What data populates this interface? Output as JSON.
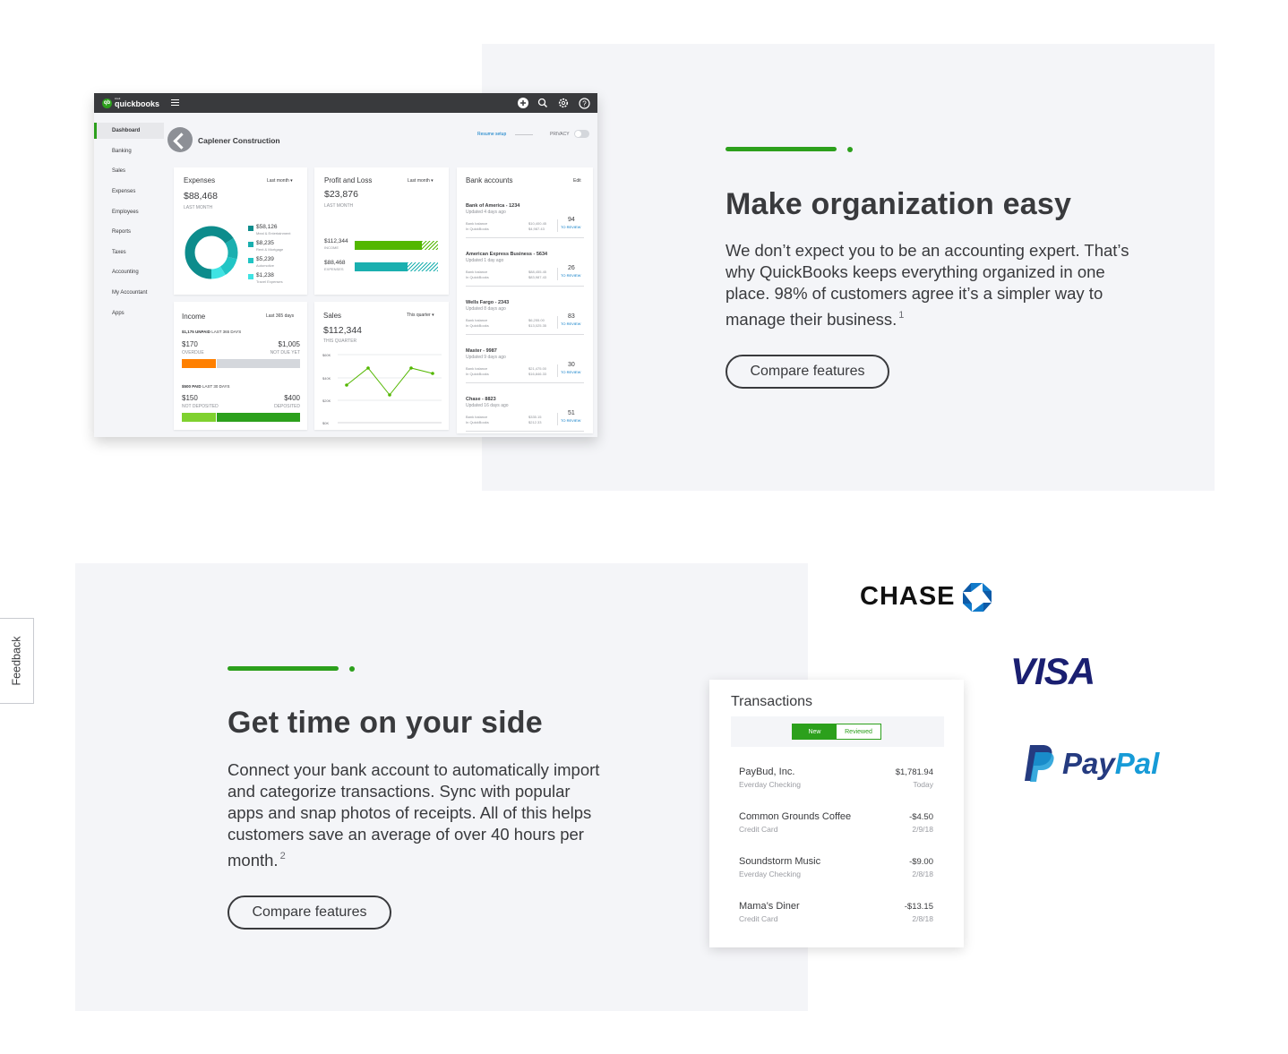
{
  "feedback": {
    "label": "Feedback"
  },
  "section1": {
    "heading": "Make organization easy",
    "body": "We don’t expect you to be an accounting expert. That’s why QuickBooks keeps everything organized in one place. 98% of customers agree it’s a simpler way to manage their business.",
    "footnote": "1",
    "button": "Compare features"
  },
  "section2": {
    "heading": "Get time on your side",
    "body": "Connect your bank account to automatically import and categorize transactions. Sync with popular apps and snap photos of receipts. All of this helps customers save an average of over 40 hours per month.",
    "footnote": "2",
    "button": "Compare features"
  },
  "dashboard": {
    "logo": {
      "badge": "qb",
      "top": "intuit",
      "text": "quickbooks"
    },
    "top_icons": [
      "plus-icon",
      "search-icon",
      "gear-icon",
      "help-icon"
    ],
    "sidebar": [
      "Dashboard",
      "Banking",
      "Sales",
      "Expenses",
      "Employees",
      "Reports",
      "Taxes",
      "Accounting",
      "My Accountant",
      "Apps"
    ],
    "company": "Caplener Construction",
    "resume": "Resume setup",
    "privacy": "PRIVACY",
    "expenses": {
      "title": "Expenses",
      "period": "Last month",
      "total": "$88,468",
      "sub": "LAST MONTH",
      "legend": [
        {
          "amount": "$58,126",
          "label": "Meal & Entertainment",
          "color": "#0d8c8c"
        },
        {
          "amount": "$8,235",
          "label": "Rent & Mortgage",
          "color": "#1aafaf"
        },
        {
          "amount": "$5,239",
          "label": "Automotive",
          "color": "#21c5c5"
        },
        {
          "amount": "$1,238",
          "label": "Travel Expenses",
          "color": "#3fe3e3"
        }
      ]
    },
    "pnl": {
      "title": "Profit and Loss",
      "period": "Last month",
      "total": "$23,876",
      "sub": "LAST MONTH",
      "income_value": "$112,344",
      "income_label": "INCOME",
      "expenses_value": "$88,468",
      "expenses_label": "EXPENSES"
    },
    "bank": {
      "title": "Bank accounts",
      "edit": "Edit",
      "bank_balance": "Bank balance",
      "in_qb": "In QuickBooks",
      "to_review": "TO REVIEW",
      "accounts": [
        {
          "name": "Bank of America - 1234",
          "updated": "Updated 4 days ago",
          "bank": "$10,400.45",
          "qb": "$4,987.43",
          "count": "94"
        },
        {
          "name": "American Express Business - 5634",
          "updated": "Updated 1 day ago",
          "bank": "$88,455.45",
          "qb": "$83,987.43",
          "count": "26"
        },
        {
          "name": "Wells Fargo - 2343",
          "updated": "Updated 8 days ago",
          "bank": "$6,255.00",
          "qb": "$13,025.35",
          "count": "83"
        },
        {
          "name": "Master - 9987",
          "updated": "Updated 9 days ago",
          "bank": "$21,475.00",
          "qb": "$16,846.33",
          "count": "30"
        },
        {
          "name": "Chase - 8823",
          "updated": "Updated 16 days ago",
          "bank": "$335.15",
          "qb": "$212.33",
          "count": "51"
        }
      ]
    },
    "income": {
      "title": "Income",
      "period": "Last 365 days",
      "unpaid": "$1,175 UNPAID",
      "unpaid_period": "LAST 365 DAYS",
      "overdue_value": "$170",
      "overdue_label": "OVERDUE",
      "notdue_value": "$1,005",
      "notdue_label": "NOT DUE YET",
      "paid": "$500 PAID",
      "paid_period": "LAST 30 DAYS",
      "notdep_value": "$150",
      "notdep_label": "NOT DEPOSITED",
      "dep_value": "$400",
      "dep_label": "DEPOSITED"
    },
    "sales": {
      "title": "Sales",
      "period": "This quarter",
      "total": "$112,344",
      "sub": "THIS QUARTER",
      "y_ticks": [
        "$60K",
        "$40K",
        "$20K",
        "$0K"
      ]
    }
  },
  "transactions": {
    "title": "Transactions",
    "tab_new": "New",
    "tab_reviewed": "Reviewed",
    "items": [
      {
        "name": "PayBud, Inc.",
        "account": "Everday Checking",
        "amount": "$1,781.94",
        "date": "Today"
      },
      {
        "name": "Common Grounds Coffee",
        "account": "Credit Card",
        "amount": "-$4.50",
        "date": "2/9/18"
      },
      {
        "name": "Soundstorm Music",
        "account": "Everday Checking",
        "amount": "-$9.00",
        "date": "2/8/18"
      },
      {
        "name": "Mama’s Diner",
        "account": "Credit Card",
        "amount": "-$13.15",
        "date": "2/8/18"
      }
    ]
  },
  "logos": {
    "chase": "CHASE",
    "visa": "VISA",
    "paypal_a": "Pay",
    "paypal_b": "Pal"
  }
}
